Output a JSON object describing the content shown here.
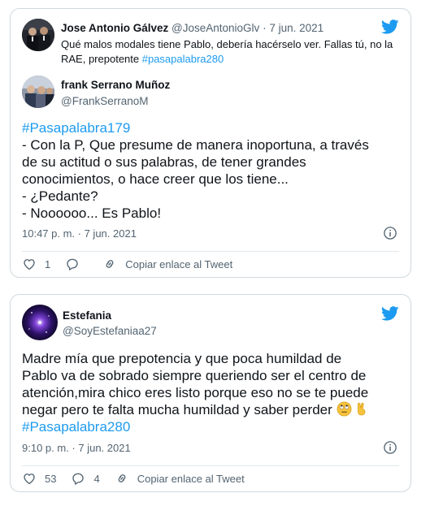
{
  "tweet1": {
    "author_name": "Jose Antonio Gálvez",
    "author_handle": "@JoseAntonioGlv",
    "separator": "·",
    "date": "7 jun. 2021",
    "text_part1": "Qué malos modales tiene Pablo, debería hacérselo ver. Fallas tú, no la RAE, prepotente ",
    "hashtag": "#pasapalabra280",
    "quoted": {
      "author_name": "frank Serrano Muñoz",
      "author_handle": "@FrankSerranoM",
      "lines": [
        "#Pasapalabra179",
        "- Con la P, Que presume de manera inoportuna, a través",
        "de su actitud o sus palabras, de tener grandes",
        "conocimientos, o hace creer que los tiene...",
        "- ¿Pedante?",
        "- Noooooo... Es Pablo!"
      ]
    },
    "timestamp": "10:47 p. m. · 7 jun. 2021",
    "likes": "1",
    "copy_link": "Copiar enlace al Tweet"
  },
  "tweet2": {
    "author_name": "Estefania",
    "author_handle": "@SoyEstefaniaa27",
    "lines": [
      "Madre mía que prepotencia y que poca humildad de",
      "Pablo va de sobrado siempre queriendo ser el centro de",
      "atención,mira chico eres listo porque eso no se te puede",
      "negar pero te falta mucha humildad y saber perder "
    ],
    "hashtag": "#Pasapalabra280",
    "timestamp": "9:10 p. m. · 7 jun. 2021",
    "likes": "53",
    "replies": "4",
    "copy_link": "Copiar enlace al Tweet"
  },
  "colors": {
    "link": "#1d9bf0",
    "secondary_text": "#536471",
    "border": "#cfd9de"
  },
  "icons": [
    "twitter-bird-icon",
    "info-icon",
    "heart-icon",
    "reply-icon",
    "link-icon",
    "eye-roll-emoji",
    "victory-hand-emoji"
  ]
}
